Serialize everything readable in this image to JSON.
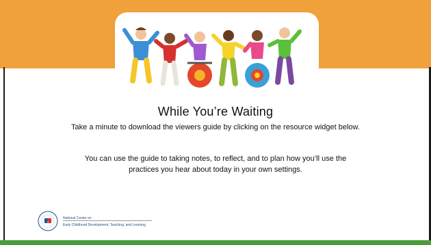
{
  "slide": {
    "title": "While You’re Waiting",
    "subtitle": "Take a minute to download the viewers guide by clicking on the resource widget below.",
    "body_line1": "You can use the guide to taking notes, to reflect, and to plan how you’ll use the",
    "body_line2": "practices you hear about today in your own settings."
  },
  "logo": {
    "line1": "National Center on",
    "line2": "Early Childhood Development, Teaching, and Learning",
    "seal_text": "Office of Head Start National Centers"
  },
  "colors": {
    "banner": "#f0a13c",
    "bottom_bar": "#4a9c3a",
    "logo_text": "#2a4f8a"
  }
}
